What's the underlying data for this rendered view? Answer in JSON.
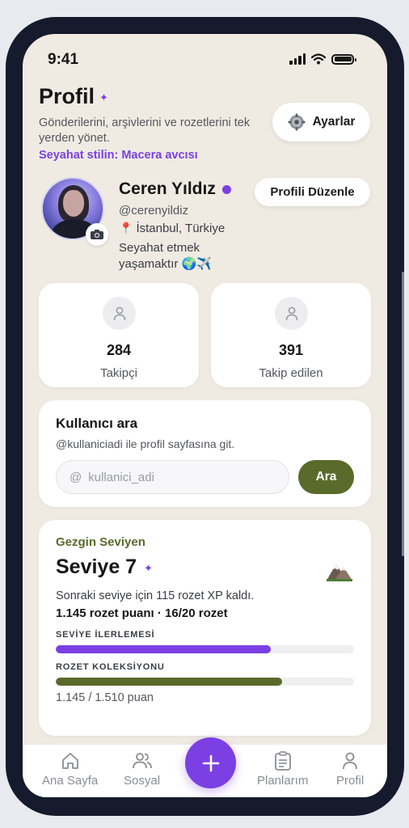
{
  "status_bar": {
    "time": "9:41"
  },
  "header": {
    "title": "Profil",
    "subtitle": "Gönderilerini, arşivlerini ve rozetlerini tek yerden yönet.",
    "travel_style": "Seyahat stilin: Macera avcısı",
    "settings_label": "Ayarlar"
  },
  "profile": {
    "name": "Ceren Yıldız",
    "handle": "@cerenyildiz",
    "location": "İstanbul, Türkiye",
    "bio": "Seyahat etmek yaşamaktır 🌍✈️",
    "edit_label": "Profili Düzenle"
  },
  "stats": [
    {
      "value": "284",
      "label": "Takipçi"
    },
    {
      "value": "391",
      "label": "Takip edilen"
    }
  ],
  "user_search": {
    "title": "Kullanıcı ara",
    "description": "@kullaniciadi ile profil sayfasına git.",
    "placeholder": "kullanici_adi",
    "prefix": "@",
    "button_label": "Ara"
  },
  "level": {
    "kicker": "Gezgin Seviyen",
    "title": "Seviye 7",
    "next_text": "Sonraki seviye için 115 rozet XP kaldı.",
    "points_text": "1.145 rozet puanı · 16/20 rozet",
    "progress_label": "SEVİYE İLERLEMESİ",
    "progress_value": 0.72,
    "collection_label": "ROZET KOLEKSİYONU",
    "collection_value": 0.758,
    "total_text": "1.145 / 1.510 puan"
  },
  "tabbar": {
    "items": [
      {
        "label": "Ana Sayfa",
        "icon": "home-icon"
      },
      {
        "label": "Sosyal",
        "icon": "users-icon"
      },
      {
        "label": "Planlarım",
        "icon": "clipboard-icon"
      },
      {
        "label": "Profil",
        "icon": "user-icon"
      }
    ]
  },
  "colors": {
    "accent_purple": "#7b3fe4",
    "accent_olive": "#5a6a2b",
    "background": "#efebe3"
  }
}
